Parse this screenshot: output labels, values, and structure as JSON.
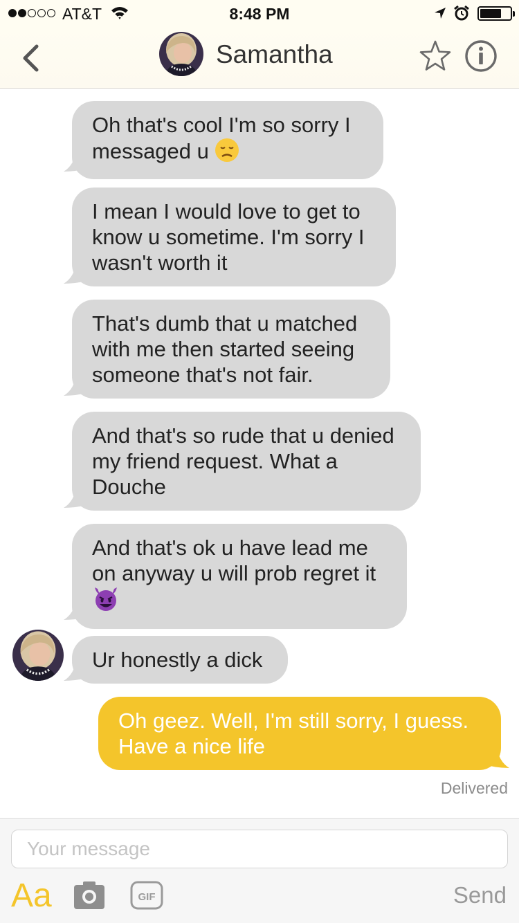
{
  "status_bar": {
    "carrier": "AT&T",
    "time": "8:48 PM",
    "signal_bars_filled": 2,
    "signal_bars_total": 5,
    "battery_level": 0.75,
    "icons": [
      "wifi-icon",
      "location-icon",
      "alarm-icon",
      "battery-icon"
    ]
  },
  "header": {
    "contact_name": "Samantha",
    "icons": [
      "back-chevron-icon",
      "star-icon",
      "info-icon"
    ]
  },
  "messages": [
    {
      "direction": "incoming",
      "text": "Oh that's cool I'm so sorry I messaged u",
      "emoji": "disappointed-face"
    },
    {
      "direction": "incoming",
      "text": "I mean I would love to get to know u sometime. I'm sorry I wasn't worth it"
    },
    {
      "direction": "incoming",
      "text": "That's dumb that u matched with me then started seeing someone that's not fair."
    },
    {
      "direction": "incoming",
      "text": "And that's so rude that u denied my friend request. What a Douche"
    },
    {
      "direction": "incoming",
      "text": "And that's ok u have lead me on anyway u will prob regret it",
      "emoji": "smiling-devil"
    },
    {
      "direction": "incoming",
      "text": "Ur honestly a dick"
    },
    {
      "direction": "outgoing",
      "text": "Oh geez. Well, I'm still sorry, I guess. Have a nice life"
    }
  ],
  "delivery_status": "Delivered",
  "composer": {
    "placeholder": "Your message",
    "value": "",
    "font_label": "Aa",
    "gif_label": "GIF",
    "send_label": "Send"
  },
  "colors": {
    "accent": "#f4c52b",
    "incoming_bubble": "#d8d8d8",
    "header_background": "#fffdf2"
  }
}
